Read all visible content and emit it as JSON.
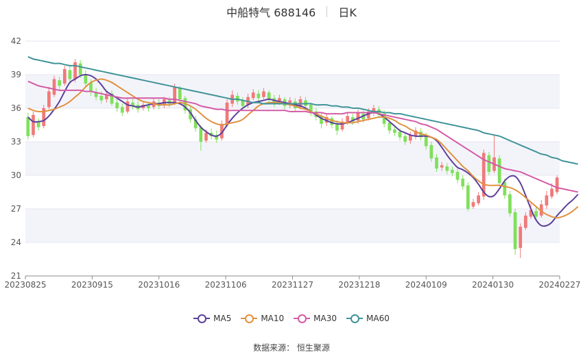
{
  "header": {
    "name": "中船特气 688146",
    "period": "日K"
  },
  "legend": [
    {
      "name": "MA5",
      "color": "#5b3f9a"
    },
    {
      "name": "MA10",
      "color": "#e0913f"
    },
    {
      "name": "MA30",
      "color": "#d45aa5"
    },
    {
      "name": "MA60",
      "color": "#3f9398"
    }
  ],
  "source": "数据来源： 恒生聚源",
  "chart_data": {
    "type": "candlestick",
    "ylim": [
      21,
      42
    ],
    "yticks": [
      21,
      24,
      27,
      30,
      33,
      36,
      39,
      42
    ],
    "xtick_labels": [
      "20230825",
      "20230915",
      "20231016",
      "20231106",
      "20231127",
      "20231218",
      "20240109",
      "20240130",
      "20240227"
    ],
    "up_color": "#f07a7a",
    "down_color": "#7fe05a",
    "candles": [
      [
        35.2,
        33.5,
        35.6,
        33.2
      ],
      [
        33.6,
        35.4,
        35.7,
        33.4
      ],
      [
        34.8,
        34.3,
        35.1,
        34.0
      ],
      [
        34.4,
        36.0,
        36.3,
        34.2
      ],
      [
        36.1,
        37.5,
        37.9,
        35.9
      ],
      [
        37.2,
        38.6,
        38.9,
        37.0
      ],
      [
        38.5,
        38.0,
        38.8,
        37.6
      ],
      [
        38.2,
        39.5,
        39.8,
        38.0
      ],
      [
        39.4,
        38.6,
        39.9,
        38.2
      ],
      [
        38.6,
        40.1,
        40.4,
        38.3
      ],
      [
        40.0,
        39.0,
        40.3,
        38.7
      ],
      [
        39.0,
        38.2,
        39.4,
        37.9
      ],
      [
        38.3,
        37.5,
        38.6,
        37.1
      ],
      [
        37.4,
        37.0,
        37.8,
        36.7
      ],
      [
        37.1,
        36.7,
        37.5,
        36.4
      ],
      [
        36.8,
        37.2,
        37.5,
        36.5
      ],
      [
        37.3,
        36.4,
        37.6,
        36.2
      ],
      [
        36.5,
        36.0,
        36.8,
        35.7
      ],
      [
        36.1,
        35.6,
        36.4,
        35.3
      ],
      [
        35.7,
        36.6,
        36.9,
        35.5
      ],
      [
        36.5,
        36.2,
        36.8,
        35.9
      ],
      [
        36.3,
        35.9,
        36.6,
        35.6
      ],
      [
        36.0,
        36.3,
        36.6,
        35.8
      ],
      [
        36.2,
        36.0,
        36.5,
        35.7
      ],
      [
        36.1,
        36.6,
        36.9,
        35.9
      ],
      [
        36.5,
        36.2,
        36.8,
        35.9
      ],
      [
        36.3,
        36.8,
        37.0,
        36.0
      ],
      [
        36.7,
        36.4,
        37.0,
        36.1
      ],
      [
        36.5,
        37.9,
        38.2,
        36.3
      ],
      [
        37.8,
        36.8,
        38.0,
        36.5
      ],
      [
        36.9,
        35.8,
        37.1,
        35.5
      ],
      [
        35.9,
        35.0,
        36.1,
        34.7
      ],
      [
        35.0,
        34.2,
        35.3,
        33.9
      ],
      [
        34.3,
        33.0,
        34.5,
        32.2
      ],
      [
        33.1,
        33.8,
        34.1,
        32.9
      ],
      [
        33.8,
        33.5,
        34.2,
        33.2
      ],
      [
        33.6,
        33.2,
        34.0,
        32.9
      ],
      [
        33.3,
        34.6,
        34.9,
        33.1
      ],
      [
        34.5,
        36.5,
        36.8,
        34.3
      ],
      [
        36.4,
        37.2,
        37.6,
        36.1
      ],
      [
        37.1,
        36.6,
        37.4,
        36.3
      ],
      [
        36.7,
        36.2,
        37.0,
        35.9
      ],
      [
        36.3,
        37.0,
        37.3,
        36.0
      ],
      [
        36.9,
        37.4,
        37.7,
        36.7
      ],
      [
        37.3,
        36.9,
        37.6,
        36.6
      ],
      [
        37.0,
        37.5,
        37.8,
        36.8
      ],
      [
        37.4,
        36.8,
        37.6,
        36.5
      ],
      [
        36.9,
        36.4,
        37.2,
        36.1
      ],
      [
        36.5,
        36.9,
        37.2,
        36.3
      ],
      [
        36.8,
        36.2,
        37.0,
        35.9
      ],
      [
        36.3,
        36.7,
        37.0,
        36.0
      ],
      [
        36.6,
        36.0,
        36.9,
        35.7
      ],
      [
        36.1,
        36.8,
        37.1,
        35.9
      ],
      [
        36.7,
        36.2,
        37.0,
        35.9
      ],
      [
        36.3,
        35.6,
        36.5,
        35.3
      ],
      [
        35.7,
        35.2,
        36.0,
        34.9
      ],
      [
        35.3,
        34.6,
        35.6,
        34.2
      ],
      [
        34.7,
        35.2,
        35.5,
        34.4
      ],
      [
        35.1,
        34.5,
        35.3,
        34.2
      ],
      [
        34.6,
        34.0,
        34.9,
        33.6
      ],
      [
        34.1,
        34.8,
        35.1,
        33.9
      ],
      [
        34.7,
        35.3,
        35.6,
        34.5
      ],
      [
        35.2,
        34.8,
        35.5,
        34.5
      ],
      [
        34.9,
        35.6,
        35.9,
        34.6
      ],
      [
        35.5,
        35.0,
        35.8,
        34.7
      ],
      [
        35.1,
        35.7,
        36.0,
        34.9
      ],
      [
        35.6,
        36.0,
        36.3,
        35.3
      ],
      [
        35.9,
        35.4,
        36.2,
        35.1
      ],
      [
        35.5,
        34.6,
        35.8,
        34.3
      ],
      [
        34.7,
        34.0,
        35.0,
        33.7
      ],
      [
        34.1,
        33.8,
        34.4,
        33.5
      ],
      [
        33.9,
        33.4,
        34.2,
        33.1
      ],
      [
        33.5,
        33.0,
        33.8,
        32.7
      ],
      [
        33.1,
        33.6,
        33.9,
        32.8
      ],
      [
        33.5,
        34.0,
        34.3,
        33.2
      ],
      [
        33.9,
        33.4,
        34.2,
        33.1
      ],
      [
        33.5,
        32.6,
        33.8,
        32.3
      ],
      [
        32.7,
        31.5,
        33.0,
        31.2
      ],
      [
        31.6,
        30.6,
        31.9,
        30.3
      ],
      [
        30.7,
        30.9,
        31.2,
        30.4
      ],
      [
        30.8,
        30.4,
        31.1,
        30.1
      ],
      [
        30.5,
        30.2,
        30.8,
        29.9
      ],
      [
        30.3,
        29.6,
        30.6,
        29.3
      ],
      [
        29.7,
        29.0,
        30.0,
        28.7
      ],
      [
        29.1,
        27.0,
        29.4,
        26.8
      ],
      [
        27.2,
        27.6,
        27.9,
        27.0
      ],
      [
        27.5,
        28.2,
        28.5,
        27.3
      ],
      [
        28.1,
        32.0,
        32.3,
        27.8
      ],
      [
        31.8,
        30.3,
        32.1,
        30.0
      ],
      [
        30.4,
        31.6,
        33.6,
        30.2
      ],
      [
        31.5,
        29.3,
        31.8,
        29.0
      ],
      [
        29.4,
        28.2,
        29.7,
        27.9
      ],
      [
        28.3,
        26.6,
        28.6,
        26.3
      ],
      [
        26.7,
        23.4,
        27.0,
        22.9
      ],
      [
        23.5,
        25.4,
        25.7,
        22.6
      ],
      [
        25.3,
        26.4,
        26.7,
        25.1
      ],
      [
        26.3,
        26.9,
        27.5,
        26.1
      ],
      [
        26.8,
        26.3,
        27.2,
        26.0
      ],
      [
        26.4,
        27.4,
        27.8,
        26.2
      ],
      [
        27.3,
        28.2,
        28.6,
        27.0
      ],
      [
        28.1,
        28.8,
        29.3,
        27.9
      ],
      [
        28.5,
        29.8,
        30.0,
        28.3
      ]
    ],
    "series": [
      {
        "name": "MA5",
        "color": "#5b3f9a",
        "values": [
          35.2,
          34.8,
          34.8,
          34.9,
          35.3,
          35.9,
          36.6,
          37.5,
          38.3,
          38.6,
          38.9,
          39.0,
          38.9,
          38.6,
          38.1,
          37.5,
          37.2,
          36.9,
          36.6,
          36.3,
          36.2,
          36.1,
          36.2,
          36.3,
          36.4,
          36.4,
          36.5,
          36.5,
          36.5,
          36.4,
          36.1,
          35.6,
          34.9,
          34.3,
          33.9,
          33.6,
          33.5,
          33.8,
          34.5,
          35.1,
          35.6,
          36.0,
          36.3,
          36.5,
          36.6,
          36.7,
          36.8,
          36.7,
          36.6,
          36.5,
          36.4,
          36.3,
          36.2,
          36.0,
          35.7,
          35.4,
          35.1,
          34.9,
          34.7,
          34.6,
          34.6,
          34.7,
          34.9,
          35.1,
          35.3,
          35.5,
          35.6,
          35.5,
          35.2,
          34.8,
          34.4,
          34.0,
          33.8,
          33.6,
          33.5,
          33.5,
          33.5,
          33.4,
          33.1,
          32.5,
          31.8,
          31.2,
          30.7,
          30.5,
          30.2,
          29.8,
          29.2,
          28.5,
          28.1,
          28.2,
          28.8,
          29.5,
          29.9,
          29.9,
          29.3,
          28.2,
          27.0,
          26.0,
          25.5,
          25.5,
          25.8,
          26.4,
          26.9,
          27.4,
          27.8,
          28.3
        ]
      },
      {
        "name": "MA10",
        "color": "#e0913f",
        "values": [
          36.0,
          35.8,
          35.7,
          35.7,
          35.8,
          35.9,
          36.1,
          36.3,
          36.6,
          37.0,
          37.4,
          37.9,
          38.3,
          38.5,
          38.6,
          38.5,
          38.3,
          38.0,
          37.7,
          37.4,
          37.1,
          36.8,
          36.6,
          36.5,
          36.4,
          36.3,
          36.3,
          36.3,
          36.4,
          36.5,
          36.4,
          36.2,
          35.9,
          35.5,
          35.1,
          34.8,
          34.6,
          34.5,
          34.6,
          34.7,
          34.8,
          35.0,
          35.4,
          35.8,
          36.2,
          36.4,
          36.5,
          36.5,
          36.5,
          36.4,
          36.3,
          36.2,
          36.0,
          35.9,
          35.7,
          35.5,
          35.3,
          35.1,
          34.9,
          34.8,
          34.7,
          34.7,
          34.7,
          34.8,
          34.9,
          35.0,
          35.1,
          35.2,
          35.2,
          35.1,
          34.9,
          34.6,
          34.4,
          34.1,
          33.9,
          33.7,
          33.6,
          33.4,
          33.2,
          32.8,
          32.3,
          31.8,
          31.3,
          30.8,
          30.4,
          29.9,
          29.5,
          29.2,
          29.1,
          29.1,
          29.1,
          29.0,
          28.9,
          28.7,
          28.4,
          28.0,
          27.6,
          27.2,
          26.8,
          26.5,
          26.3,
          26.2,
          26.3,
          26.5,
          26.8,
          27.2
        ]
      },
      {
        "name": "MA30",
        "color": "#d45aa5",
        "values": [
          38.4,
          38.2,
          38.0,
          37.9,
          37.8,
          37.7,
          37.6,
          37.6,
          37.6,
          37.6,
          37.6,
          37.5,
          37.5,
          37.4,
          37.3,
          37.2,
          37.1,
          37.0,
          36.9,
          36.9,
          36.9,
          36.9,
          36.9,
          36.9,
          36.9,
          36.9,
          36.9,
          36.8,
          36.8,
          36.7,
          36.6,
          36.5,
          36.4,
          36.2,
          36.1,
          36.0,
          35.9,
          35.9,
          35.8,
          35.8,
          35.8,
          35.8,
          35.8,
          35.8,
          35.8,
          35.8,
          35.8,
          35.8,
          35.8,
          35.8,
          35.7,
          35.7,
          35.7,
          35.7,
          35.6,
          35.6,
          35.6,
          35.5,
          35.5,
          35.5,
          35.5,
          35.6,
          35.6,
          35.6,
          35.6,
          35.6,
          35.6,
          35.5,
          35.4,
          35.3,
          35.2,
          35.1,
          35.0,
          34.9,
          34.8,
          34.6,
          34.5,
          34.3,
          34.1,
          33.8,
          33.5,
          33.2,
          32.9,
          32.6,
          32.3,
          32.0,
          31.7,
          31.4,
          31.2,
          31.0,
          30.8,
          30.6,
          30.5,
          30.4,
          30.3,
          30.1,
          29.9,
          29.7,
          29.5,
          29.3,
          29.1,
          28.9,
          28.8,
          28.7,
          28.6,
          28.5
        ]
      },
      {
        "name": "MA60",
        "color": "#3f9398",
        "values": [
          40.6,
          40.4,
          40.3,
          40.2,
          40.1,
          40.0,
          40.0,
          39.9,
          39.8,
          39.8,
          39.7,
          39.6,
          39.5,
          39.4,
          39.3,
          39.2,
          39.1,
          39.0,
          38.9,
          38.8,
          38.7,
          38.6,
          38.5,
          38.4,
          38.3,
          38.2,
          38.1,
          38.0,
          37.9,
          37.8,
          37.7,
          37.6,
          37.5,
          37.4,
          37.3,
          37.2,
          37.1,
          37.0,
          36.9,
          36.8,
          36.8,
          36.7,
          36.6,
          36.5,
          36.5,
          36.4,
          36.4,
          36.4,
          36.4,
          36.4,
          36.4,
          36.4,
          36.4,
          36.4,
          36.4,
          36.3,
          36.3,
          36.3,
          36.2,
          36.2,
          36.1,
          36.1,
          36.0,
          36.0,
          35.9,
          35.8,
          35.7,
          35.7,
          35.6,
          35.6,
          35.5,
          35.5,
          35.4,
          35.3,
          35.2,
          35.1,
          35.0,
          34.9,
          34.8,
          34.7,
          34.6,
          34.5,
          34.4,
          34.3,
          34.2,
          34.1,
          34.0,
          33.8,
          33.7,
          33.6,
          33.5,
          33.3,
          33.1,
          32.9,
          32.7,
          32.5,
          32.3,
          32.1,
          31.9,
          31.8,
          31.6,
          31.5,
          31.3,
          31.2,
          31.1,
          31.0
        ]
      }
    ]
  }
}
